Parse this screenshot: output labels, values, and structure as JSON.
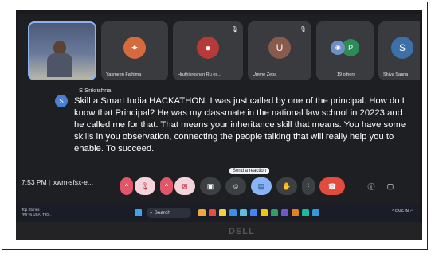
{
  "tiles": [
    {
      "name": "",
      "type": "camera"
    },
    {
      "name": "Yasmeen Fathima",
      "avatar_color": "#d46a3e",
      "muted": false
    },
    {
      "name": "Hruthikroshan Ru es...",
      "avatar_color": "#b63a3a",
      "muted": true
    },
    {
      "name": "Umme Zeba",
      "initial": "U",
      "avatar_color": "#8a5a4a",
      "muted": true
    },
    {
      "name": "19 others",
      "initial": "P",
      "avatar_color": "#2e8b57",
      "muted": false
    },
    {
      "name": "Shiva Sanna",
      "initial": "S",
      "avatar_color": "#3d6fa8",
      "muted": false
    }
  ],
  "caption": {
    "initial": "S",
    "speaker": "S Srikrishna",
    "text": "Skill a Smart India HACKATHON. I was just called by one of the principal. How do I know that Principal? He was my classmate in the national law school in 20223 and he called me for that. That means your inheritance skill that means. You have some skills in you observation, connecting the people talking that will really help you to enable. To succeed."
  },
  "controls": {
    "time": "7:53 PM",
    "meeting_code": "xwm-sfsx-e...",
    "tooltip": "Send a reaction",
    "buttons": [
      {
        "icon": "chevron-up-icon",
        "glyph": "^"
      },
      {
        "icon": "mic-off-icon",
        "glyph": "🎙"
      },
      {
        "icon": "chevron-up-icon",
        "glyph": "^"
      },
      {
        "icon": "camera-off-icon",
        "glyph": "⊠"
      },
      {
        "icon": "closed-captions-icon",
        "glyph": "▣"
      },
      {
        "icon": "emoji-reaction-icon",
        "glyph": "☺"
      },
      {
        "icon": "present-screen-icon",
        "glyph": "▤"
      },
      {
        "icon": "raise-hand-icon",
        "glyph": "✋"
      },
      {
        "icon": "more-options-icon",
        "glyph": "⋮"
      },
      {
        "icon": "hang-up-icon",
        "glyph": "☎"
      },
      {
        "icon": "info-icon",
        "glyph": "ⓘ"
      },
      {
        "icon": "chat-icon",
        "glyph": "▢"
      }
    ]
  },
  "taskbar": {
    "weather_line1": "Top Stories",
    "weather_line2": "RW vs USA: T20...",
    "search_label": "Search",
    "tray_text": "ENG IN"
  },
  "bezel": {
    "logo": "DELL"
  }
}
